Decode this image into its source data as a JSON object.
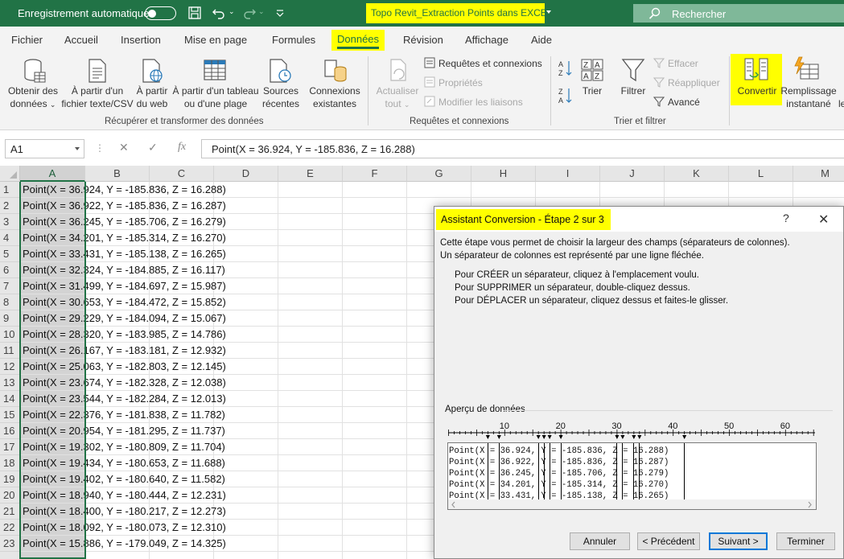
{
  "titlebar": {
    "autosave_label": "Enregistrement automatique",
    "document_title": "Topo Revit_Extraction Points dans EXCEL",
    "search_placeholder": "Rechercher"
  },
  "tabs": [
    {
      "label": "Fichier"
    },
    {
      "label": "Accueil"
    },
    {
      "label": "Insertion"
    },
    {
      "label": "Mise en page"
    },
    {
      "label": "Formules"
    },
    {
      "label": "Données",
      "active": true
    },
    {
      "label": "Révision"
    },
    {
      "label": "Affichage"
    },
    {
      "label": "Aide"
    }
  ],
  "ribbon": {
    "get_data": {
      "obtenir_l1": "Obtenir des",
      "obtenir_l2": "données",
      "texte_l1": "À partir d'un",
      "texte_l2": "fichier texte/CSV",
      "web_l1": "À partir",
      "web_l2": "du web",
      "tableau_l1": "À partir d'un tableau",
      "tableau_l2": "ou d'une plage",
      "sources_l1": "Sources",
      "sources_l2": "récentes",
      "connexions_l1": "Connexions",
      "connexions_l2": "existantes",
      "group_label": "Récupérer et transformer des données"
    },
    "queries": {
      "actualiser_l1": "Actualiser",
      "actualiser_l2": "tout",
      "requetes": "Requêtes et connexions",
      "proprietes": "Propriétés",
      "modifier": "Modifier les liaisons",
      "group_label": "Requêtes et connexions"
    },
    "sort": {
      "trier": "Trier",
      "filtrer": "Filtrer",
      "effacer": "Effacer",
      "reappliquer": "Réappliquer",
      "avance": "Avancé",
      "group_label": "Trier et filtrer"
    },
    "tools": {
      "convertir": "Convertir",
      "remplissage_l1": "Remplissage",
      "remplissage_l2": "instantané",
      "cut": "le"
    }
  },
  "formula_bar": {
    "name_box": "A1",
    "formula": "Point(X = 36.924, Y = -185.836, Z = 16.288)"
  },
  "grid": {
    "columns": [
      "A",
      "B",
      "C",
      "D",
      "E",
      "F",
      "G",
      "H",
      "I",
      "J",
      "K",
      "L",
      "M"
    ],
    "rows": [
      {
        "n": "1",
        "v": "Point(X = 36.924, Y = -185.836, Z = 16.288)"
      },
      {
        "n": "2",
        "v": "Point(X = 36.922, Y = -185.836, Z = 16.287)"
      },
      {
        "n": "3",
        "v": "Point(X = 36.245, Y = -185.706, Z = 16.279)"
      },
      {
        "n": "4",
        "v": "Point(X = 34.201, Y = -185.314, Z = 16.270)"
      },
      {
        "n": "5",
        "v": "Point(X = 33.431, Y = -185.138, Z = 16.265)"
      },
      {
        "n": "6",
        "v": "Point(X = 32.324, Y = -184.885, Z = 16.117)"
      },
      {
        "n": "7",
        "v": "Point(X = 31.499, Y = -184.697, Z = 15.987)"
      },
      {
        "n": "8",
        "v": "Point(X = 30.653, Y = -184.472, Z = 15.852)"
      },
      {
        "n": "9",
        "v": "Point(X = 29.229, Y = -184.094, Z = 15.067)"
      },
      {
        "n": "10",
        "v": "Point(X = 28.320, Y = -183.985, Z = 14.786)"
      },
      {
        "n": "11",
        "v": "Point(X = 26.167, Y = -183.181, Z = 12.932)"
      },
      {
        "n": "12",
        "v": "Point(X = 25.063, Y = -182.803, Z = 12.145)"
      },
      {
        "n": "13",
        "v": "Point(X = 23.674, Y = -182.328, Z = 12.038)"
      },
      {
        "n": "14",
        "v": "Point(X = 23.544, Y = -182.284, Z = 12.013)"
      },
      {
        "n": "15",
        "v": "Point(X = 22.376, Y = -181.838, Z = 11.782)"
      },
      {
        "n": "16",
        "v": "Point(X = 20.954, Y = -181.295, Z = 11.737)"
      },
      {
        "n": "17",
        "v": "Point(X = 19.302, Y = -180.809, Z = 11.704)"
      },
      {
        "n": "18",
        "v": "Point(X = 19.434, Y = -180.653, Z = 11.688)"
      },
      {
        "n": "19",
        "v": "Point(X = 19.402, Y = -180.640, Z = 11.582)"
      },
      {
        "n": "20",
        "v": "Point(X = 18.940, Y = -180.444, Z = 12.231)"
      },
      {
        "n": "21",
        "v": "Point(X = 18.400, Y = -180.217, Z = 12.273)"
      },
      {
        "n": "22",
        "v": "Point(X = 18.092, Y = -180.073, Z = 12.310)"
      },
      {
        "n": "23",
        "v": "Point(X = 15.886, Y = -179.049, Z = 14.325)"
      }
    ]
  },
  "dialog": {
    "title": "Assistant Conversion - Étape 2 sur 3",
    "intro_l1": "Cette étape vous permet de choisir la largeur des champs (séparateurs de colonnes).",
    "intro_l2": "Un séparateur de colonnes est représenté par une ligne fléchée.",
    "instr_create": "Pour CRÉER un séparateur, cliquez à l'emplacement voulu.",
    "instr_delete": "Pour SUPPRIMER un séparateur, double-cliquez dessus.",
    "instr_move": "Pour DÉPLACER un séparateur, cliquez dessus et faites-le glisser.",
    "preview_label": "Aperçu de données",
    "ruler_labels": [
      "10",
      "20",
      "30",
      "40",
      "50",
      "60"
    ],
    "preview_lines": [
      "Point(X = 36.924, Y = -185.836, Z = 16.288)",
      "Point(X = 36.922, Y = -185.836, Z = 16.287)",
      "Point(X = 36.245, Y = -185.706, Z = 16.279)",
      "Point(X = 34.201, Y = -185.314, Z = 16.270)",
      "Point(X = 33.431, Y = -185.138, Z = 16.265)"
    ],
    "btn_annuler": "Annuler",
    "btn_precedent": "< Précédent",
    "btn_suivant": "Suivant >",
    "btn_terminer": "Terminer"
  }
}
